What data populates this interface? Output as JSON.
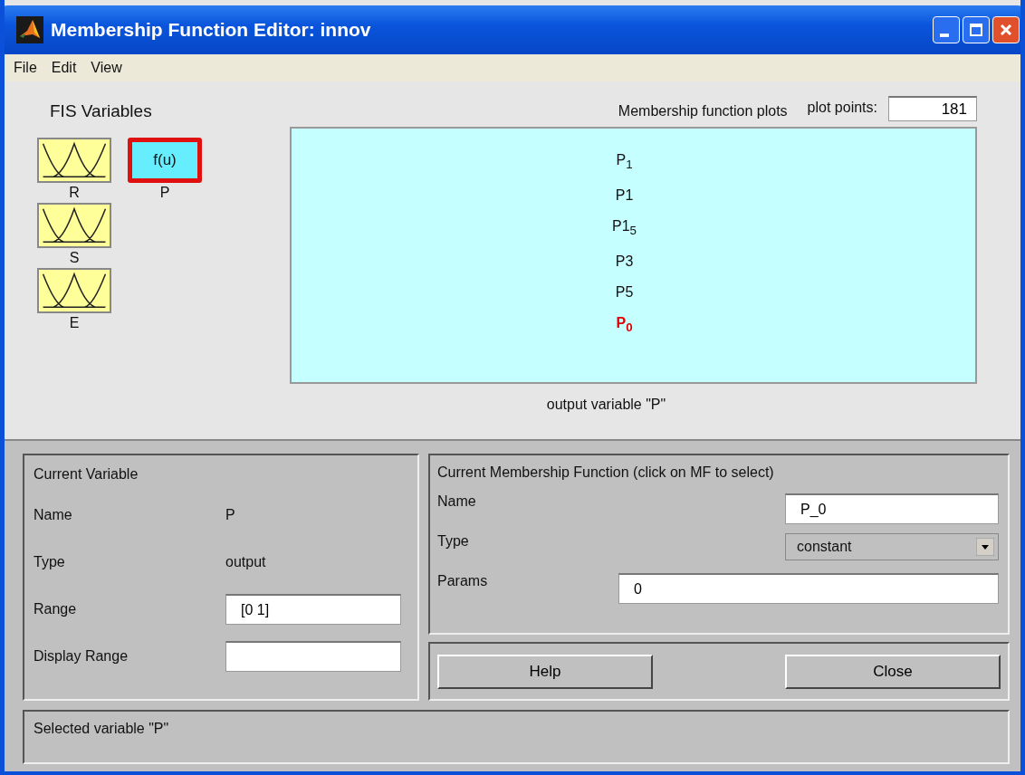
{
  "window": {
    "title": "Membership Function Editor: innov"
  },
  "menu": [
    "File",
    "Edit",
    "View"
  ],
  "fis_variables": {
    "title": "FIS Variables",
    "items": [
      {
        "name": "R",
        "kind": "input",
        "selected": false
      },
      {
        "name": "P",
        "kind": "output",
        "label": "f(u)",
        "selected": true
      },
      {
        "name": "S",
        "kind": "input",
        "selected": false
      },
      {
        "name": "E",
        "kind": "input",
        "selected": false
      }
    ]
  },
  "plot": {
    "title": "Membership function plots",
    "plot_points_label": "plot points:",
    "plot_points": "181",
    "caption": "output variable \"P\"",
    "mfs": [
      {
        "label": "P$_{1}$",
        "selected": false
      },
      {
        "label": "P1",
        "selected": false
      },
      {
        "label": "P1$_{5}$",
        "selected": false
      },
      {
        "label": "P3",
        "selected": false
      },
      {
        "label": "P5",
        "selected": false
      },
      {
        "label": "P$_{0}$",
        "selected": true
      }
    ]
  },
  "current_variable": {
    "title": "Current Variable",
    "name_label": "Name",
    "name": "P",
    "type_label": "Type",
    "type": "output",
    "range_label": "Range",
    "range": "[0 1]",
    "display_range_label": "Display Range"
  },
  "current_mf": {
    "title": "Current Membership Function (click on MF to select)",
    "name_label": "Name",
    "name": "P_0",
    "type_label": "Type",
    "type": "constant",
    "params_label": "Params",
    "params": "0"
  },
  "buttons": [
    "Help",
    "Close"
  ],
  "status": "Selected variable \"P\""
}
